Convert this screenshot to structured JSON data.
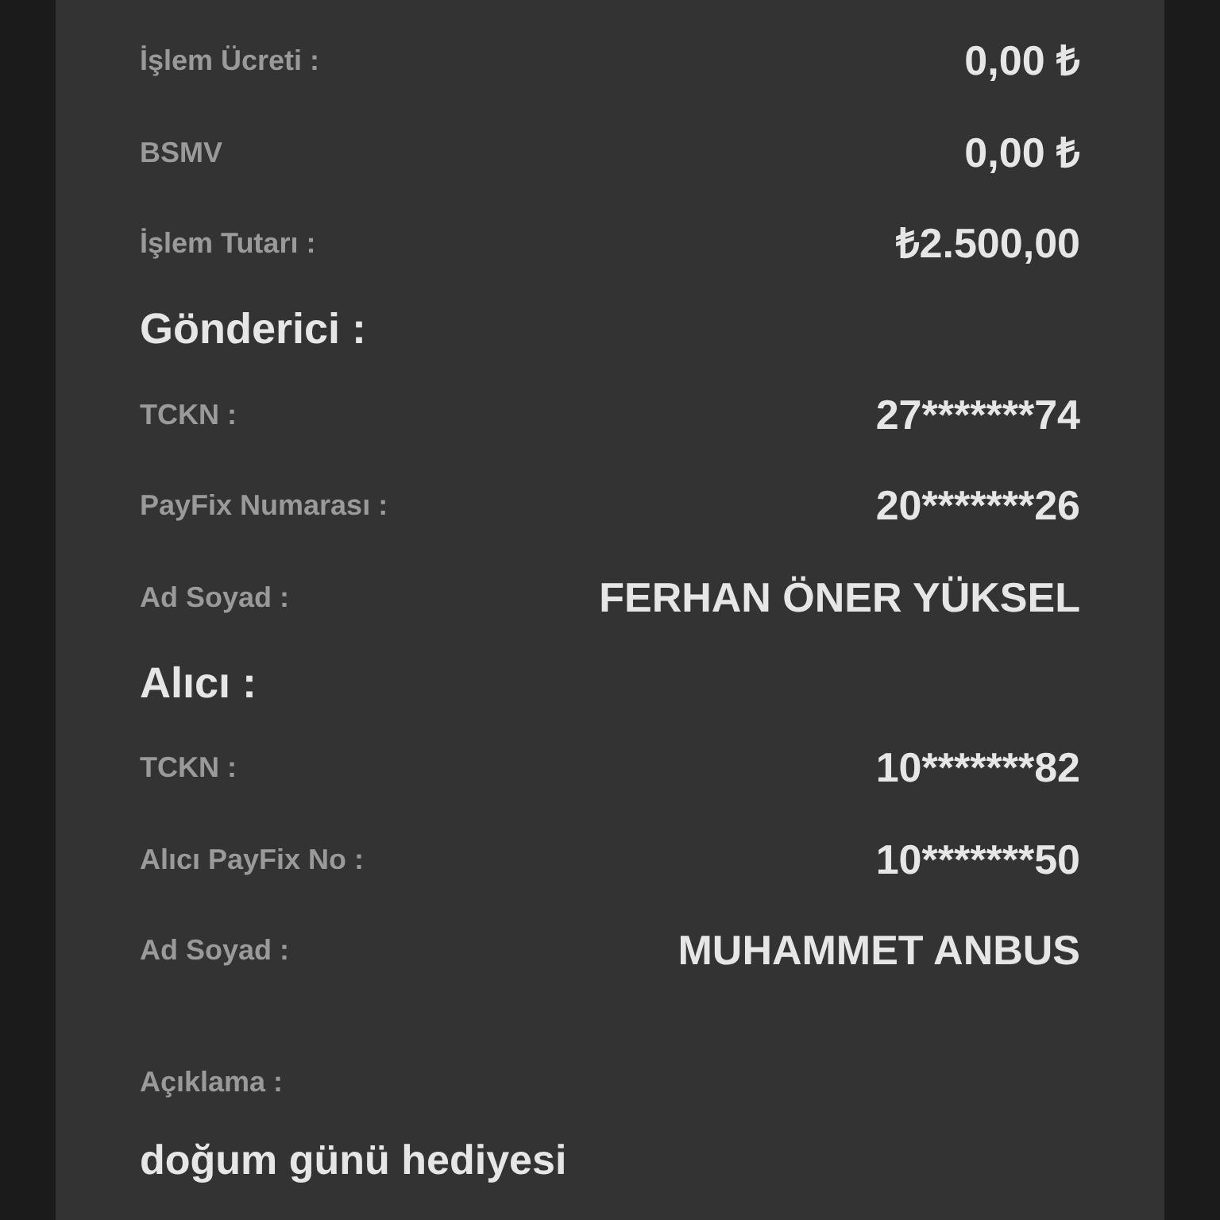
{
  "items": [
    {
      "kind": "row",
      "label": "İşlem Ücreti :",
      "value": "0,00 ₺"
    },
    {
      "kind": "row",
      "label": "BSMV",
      "value": "0,00 ₺"
    },
    {
      "kind": "row",
      "label": "İşlem Tutarı :",
      "value": "₺2.500,00"
    },
    {
      "kind": "heading",
      "text": "Gönderici :"
    },
    {
      "kind": "row",
      "label": "TCKN :",
      "value": "27*******74"
    },
    {
      "kind": "row",
      "label": "PayFix Numarası :",
      "value": "20*******26"
    },
    {
      "kind": "row",
      "label": "Ad Soyad :",
      "value": "FERHAN ÖNER YÜKSEL"
    },
    {
      "kind": "heading",
      "text": "Alıcı :"
    },
    {
      "kind": "row",
      "label": "TCKN :",
      "value": "10*******82"
    },
    {
      "kind": "row",
      "label": "Alıcı PayFix No :",
      "value": "10*******50"
    },
    {
      "kind": "row",
      "label": "Ad Soyad :",
      "value": "MUHAMMET ANBUS"
    },
    {
      "kind": "note",
      "label": "Açıklama :",
      "value": "doğum günü hediyesi"
    }
  ]
}
